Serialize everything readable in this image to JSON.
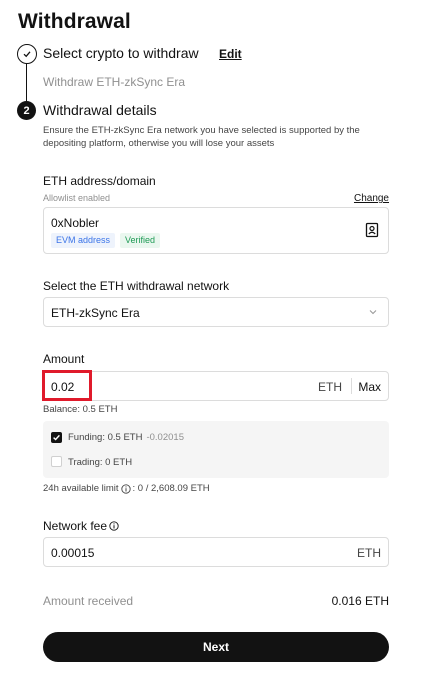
{
  "page": {
    "title": "Withdrawal"
  },
  "step1": {
    "number": "✓",
    "title": "Select crypto to withdraw",
    "edit_label": "Edit",
    "subtitle": "Withdraw ETH-zkSync Era"
  },
  "step2": {
    "number": "2",
    "title": "Withdrawal details",
    "note": "Ensure the ETH-zkSync Era network you have selected is supported by the depositing platform, otherwise you will lose your assets"
  },
  "address": {
    "label": "ETH address/domain",
    "allowlist": "Allowlist enabled",
    "change_label": "Change",
    "value": "0xNobler",
    "tags": [
      "EVM address",
      "Verified"
    ],
    "icon": "address-book-icon"
  },
  "network": {
    "label": "Select the ETH withdrawal network",
    "value": "ETH-zkSync Era",
    "icon": "chevron-down-icon"
  },
  "amount": {
    "label": "Amount",
    "value": "0.02",
    "unit": "ETH",
    "max_label": "Max",
    "balance": "Balance: 0.5 ETH",
    "accounts": [
      {
        "label": "Funding: 0.5 ETH",
        "delta": "-0.02015",
        "checked": true
      },
      {
        "label": "Trading: 0 ETH",
        "delta": "",
        "checked": false
      }
    ],
    "limit_label": "24h available limit",
    "limit_value": ": 0 / 2,608.09 ETH"
  },
  "fee": {
    "label": "Network fee",
    "value": "0.00015",
    "unit": "ETH"
  },
  "received": {
    "label": "Amount received",
    "value": "0.016 ETH"
  },
  "next_label": "Next",
  "colors": {
    "accent": "#121212",
    "highlight": "#e01a2b",
    "tag_blue": "#3b74e8",
    "tag_green": "#1e9a55"
  }
}
